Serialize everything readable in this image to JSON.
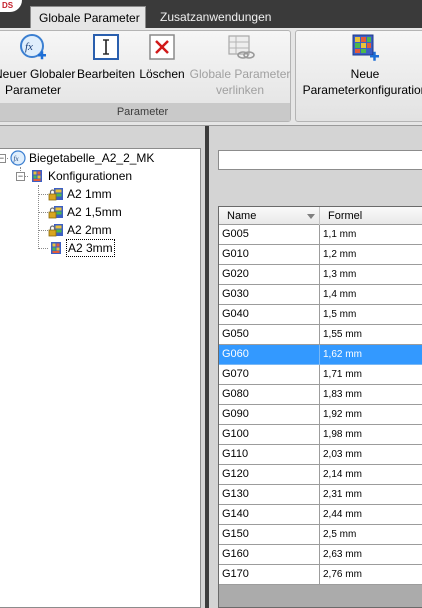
{
  "tabs": [
    {
      "label": "Globale Parameter",
      "active": true
    },
    {
      "label": "Zusatzanwendungen",
      "active": false
    }
  ],
  "ribbon": {
    "groups": [
      {
        "label": "Parameter",
        "buttons": [
          {
            "label_line1": "Neuer Globaler",
            "label_line2": "Parameter",
            "icon": "fx-add-icon",
            "enabled": true
          },
          {
            "label_line1": "Bearbeiten",
            "label_line2": "",
            "icon": "edit-text-icon",
            "enabled": true
          },
          {
            "label_line1": "Löschen",
            "label_line2": "",
            "icon": "delete-x-icon",
            "enabled": true
          },
          {
            "label_line1": "Globale Parameter",
            "label_line2": "verlinken",
            "icon": "link-table-icon",
            "enabled": false
          }
        ]
      },
      {
        "label": "",
        "buttons": [
          {
            "label_line1": "Neue",
            "label_line2": "Parameterkonfiguration",
            "icon": "grid-add-icon",
            "enabled": true
          }
        ]
      }
    ]
  },
  "tree": {
    "root": {
      "label": "Biegetabelle_A2_2_MK",
      "icon": "fx-icon"
    },
    "group": {
      "label": "Konfigurationen",
      "icon": "table-icon"
    },
    "items": [
      {
        "label": "A2 1mm",
        "icon": "locked-table-icon",
        "selected": false
      },
      {
        "label": "A2 1,5mm",
        "icon": "locked-table-icon",
        "selected": false
      },
      {
        "label": "A2 2mm",
        "icon": "locked-table-icon",
        "selected": false
      },
      {
        "label": "A2 3mm",
        "icon": "table-icon",
        "selected": true
      }
    ]
  },
  "search": {
    "value": ""
  },
  "grid": {
    "columns": [
      "Name",
      "Formel"
    ],
    "rows": [
      {
        "name": "G005",
        "formel": "1,1 mm"
      },
      {
        "name": "G010",
        "formel": "1,2 mm"
      },
      {
        "name": "G020",
        "formel": "1,3 mm"
      },
      {
        "name": "G030",
        "formel": "1,4 mm"
      },
      {
        "name": "G040",
        "formel": "1,5 mm"
      },
      {
        "name": "G050",
        "formel": "1,55 mm"
      },
      {
        "name": "G060",
        "formel": "1,62 mm"
      },
      {
        "name": "G070",
        "formel": "1,71 mm"
      },
      {
        "name": "G080",
        "formel": "1,83 mm"
      },
      {
        "name": "G090",
        "formel": "1,92 mm"
      },
      {
        "name": "G100",
        "formel": "1,98 mm"
      },
      {
        "name": "G110",
        "formel": "2,03 mm"
      },
      {
        "name": "G120",
        "formel": "2,14 mm"
      },
      {
        "name": "G130",
        "formel": "2,31 mm"
      },
      {
        "name": "G140",
        "formel": "2,44 mm"
      },
      {
        "name": "G150",
        "formel": "2,5 mm"
      },
      {
        "name": "G160",
        "formel": "2,63 mm"
      },
      {
        "name": "G170",
        "formel": "2,76 mm"
      }
    ],
    "selected_index": 6
  },
  "logo": {
    "text": "DS"
  },
  "colors": {
    "selection": "#3399ff",
    "accent_red": "#c41e2a"
  }
}
